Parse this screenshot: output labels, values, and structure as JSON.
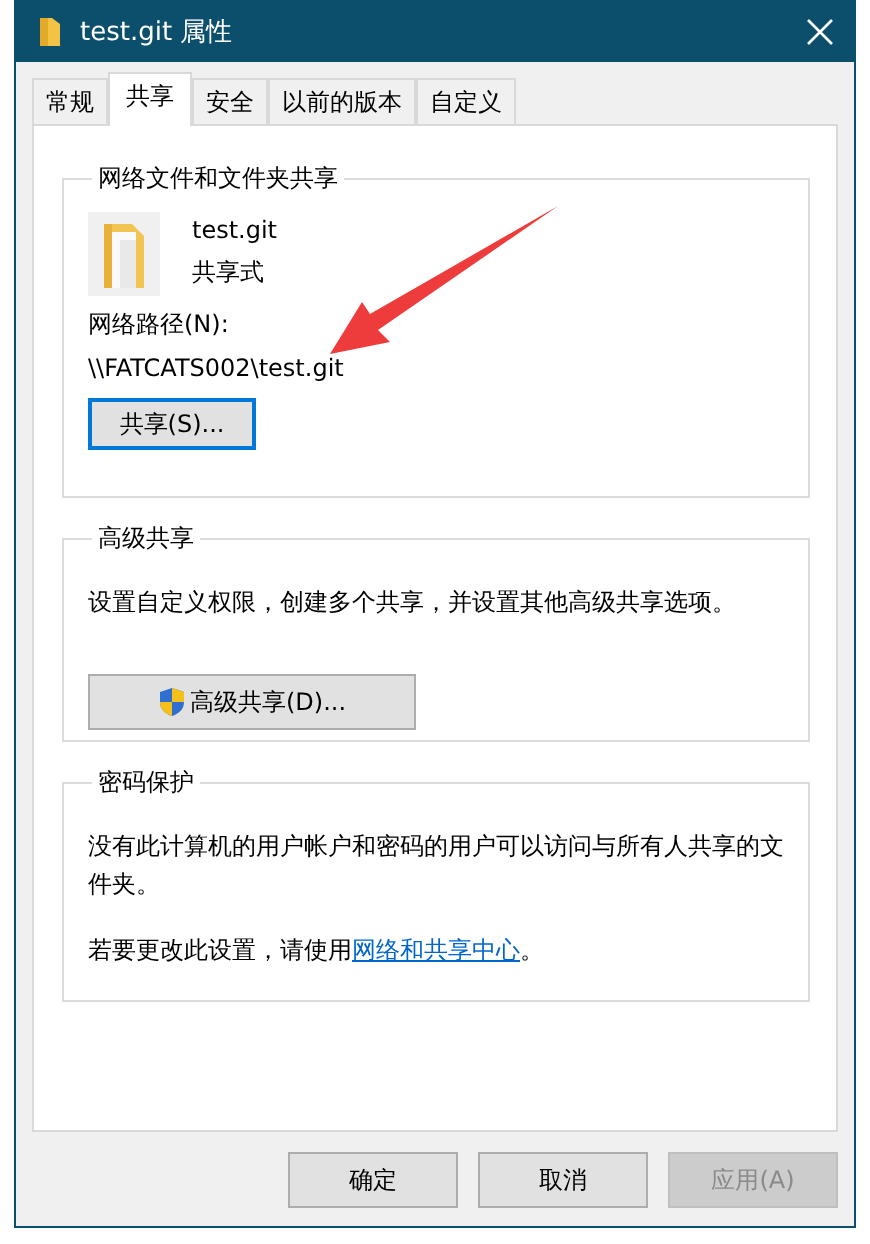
{
  "window": {
    "title": "test.git 属性"
  },
  "tabs": [
    {
      "label": "常规",
      "selected": false
    },
    {
      "label": "共享",
      "selected": true
    },
    {
      "label": "安全",
      "selected": false
    },
    {
      "label": "以前的版本",
      "selected": false
    },
    {
      "label": "自定义",
      "selected": false
    }
  ],
  "network_sharing": {
    "title": "网络文件和文件夹共享",
    "name": "test.git",
    "status": "共享式",
    "path_label": "网络路径(N):",
    "path": "\\\\FATCATS002\\test.git",
    "button": "共享(S)..."
  },
  "advanced_sharing": {
    "title": "高级共享",
    "description": "设置自定义权限，创建多个共享，并设置其他高级共享选项。",
    "button": "高级共享(D)..."
  },
  "password_protection": {
    "title": "密码保护",
    "description": "没有此计算机的用户帐户和密码的用户可以访问与所有人共享的文件夹。",
    "hint": "若要更改此设置，请使用",
    "link": "网络和共享中心",
    "hint_end": "。"
  },
  "buttons": [
    {
      "label": "确定",
      "disabled": false
    },
    {
      "label": "取消",
      "disabled": false
    },
    {
      "label": "应用(A)",
      "disabled": true
    }
  ]
}
